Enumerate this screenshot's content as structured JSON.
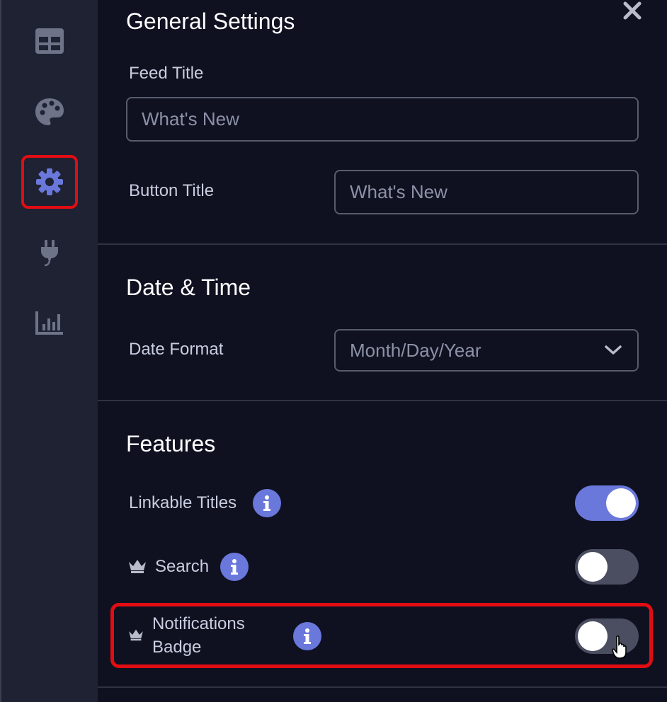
{
  "sidebar": {
    "items": [
      {
        "icon": "table-icon",
        "active": false
      },
      {
        "icon": "palette-icon",
        "active": false
      },
      {
        "icon": "gear-icon",
        "active": true,
        "highlighted": true
      },
      {
        "icon": "plug-icon",
        "active": false
      },
      {
        "icon": "bar-chart-icon",
        "active": false
      }
    ]
  },
  "general": {
    "heading": "General Settings",
    "feed_title_label": "Feed Title",
    "feed_title_placeholder": "What's New",
    "button_title_label": "Button Title",
    "button_title_placeholder": "What's New"
  },
  "datetime": {
    "heading": "Date & Time",
    "date_format_label": "Date Format",
    "date_format_value": "Month/Day/Year"
  },
  "features": {
    "heading": "Features",
    "items": [
      {
        "label": "Linkable Titles",
        "premium": false,
        "enabled": true
      },
      {
        "label": "Search",
        "premium": true,
        "enabled": false
      },
      {
        "label": "Notifications Badge",
        "premium": true,
        "enabled": false,
        "highlighted": true
      }
    ]
  },
  "colors": {
    "accent": "#6a78dc",
    "highlight": "#e10d12",
    "background": "#0f1120",
    "sidebar": "#1e2233"
  }
}
